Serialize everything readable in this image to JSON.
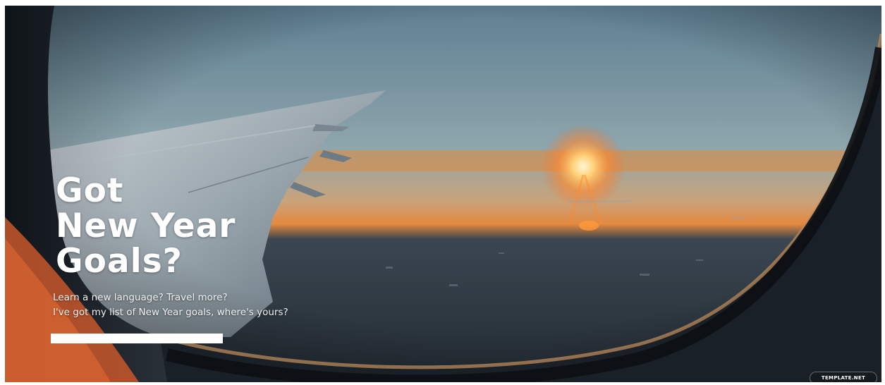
{
  "hero": {
    "headline_lines": [
      "Got",
      "New Year",
      "Goals?"
    ],
    "subtext_lines": [
      "Learn a new language? Travel more?",
      "I've got my list of New Year goals, where's yours?"
    ]
  },
  "watermark": {
    "text": "TEMPLATE.NET"
  },
  "colors": {
    "sky_top": "#6f8ea0",
    "sky_horizon": "#e79a4a",
    "sun": "#fff3c2",
    "ground": "#27313b",
    "window_frame": "#141a20",
    "frame_accent": "#c7572b",
    "text": "#ffffff"
  },
  "icons": [
    "airplane-wing-graphic",
    "sun-glow-graphic"
  ]
}
